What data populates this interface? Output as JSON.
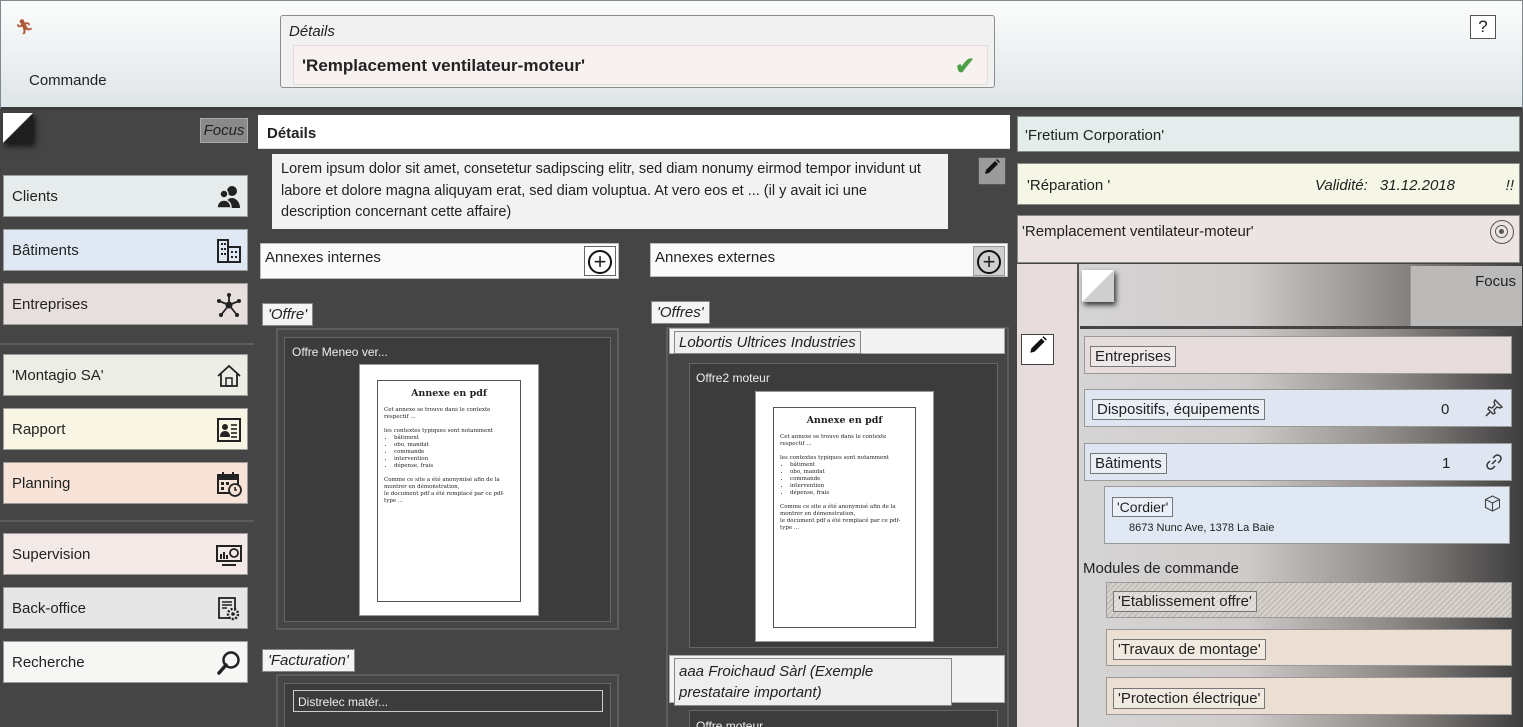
{
  "header": {
    "module_label": "Commande",
    "details_legend": "Détails",
    "details_value": "'Remplacement ventilateur-moteur'",
    "help_label": "?"
  },
  "sidebar": {
    "focus_label": "Focus",
    "items": [
      {
        "label": "Clients",
        "icon": "users-icon",
        "color": "#e6ebec"
      },
      {
        "label": "Bâtiments",
        "icon": "buildings-icon",
        "color": "#e0e8f4"
      },
      {
        "label": "Entreprises",
        "icon": "network-icon",
        "color": "#e7dede"
      },
      {
        "label": "'Montagio SA'",
        "icon": "home-icon",
        "color": "#eceee6"
      },
      {
        "label": "Rapport",
        "icon": "report-icon",
        "color": "#f9f5e4"
      },
      {
        "label": "Planning",
        "icon": "calendar-icon",
        "color": "#f7e3d7"
      },
      {
        "label": "Supervision",
        "icon": "monitor-icon",
        "color": "#f3e9e7"
      },
      {
        "label": "Back-office",
        "icon": "settings-doc-icon",
        "color": "#e6e6e6"
      },
      {
        "label": "Recherche",
        "icon": "search-icon",
        "color": "#f6f7f4"
      }
    ]
  },
  "main": {
    "title": "Détails",
    "description": "Lorem ipsum dolor sit amet, consetetur sadipscing elitr, sed diam nonumy eirmod tempor invidunt ut labore et dolore magna aliquyam erat, sed diam voluptua. At vero eos et ... (il y avait ici une description concernant cette affaire)",
    "internal_label": "Annexes internes",
    "external_label": "Annexes externes",
    "internal_groups": [
      {
        "tag": "'Offre'",
        "card_title": "Offre Meneo ver..."
      },
      {
        "tag": "'Facturation'",
        "card_title": "Distrelec matér..."
      }
    ],
    "external_groups": [
      {
        "tag": "'Offres'"
      }
    ],
    "external_firms": [
      {
        "name": "Lobortis Ultrices Industries",
        "card_title": "Offre2 moteur"
      },
      {
        "name": "aaa Froichaud Sàrl (Exemple prestataire important)",
        "card_title": "Offre moteur"
      }
    ],
    "pdf": {
      "title": "Annexe en pdf",
      "line1": "Cet annexe se trouve dans le contexte respectif ...",
      "line2": "les contextes typiques sont notamment",
      "bullets": [
        "bâtiment",
        "obo, mandat",
        "commande",
        "intervention",
        "dépense, frais"
      ],
      "line3": "Comme ce site a été anonymisé afin de la montrer en démonstration,",
      "line4": "le document pdf a été remplacé par ce pdf-type ..."
    }
  },
  "right": {
    "company": "'Fretium Corporation'",
    "type": "'Réparation '",
    "validity_label": "Validité:",
    "validity_date": "31.12.2018",
    "validity_flag": "!!",
    "order_title": "'Remplacement ventilateur-moteur'",
    "focus_label": "Focus",
    "rows": [
      {
        "label": "Entreprises",
        "count": ""
      },
      {
        "label": "Dispositifs, équipements",
        "count": "0"
      },
      {
        "label": "Bâtiments",
        "count": "1"
      }
    ],
    "building": {
      "name": "'Cordier'",
      "address": "8673 Nunc Ave, 1378 La Baie"
    },
    "modules_label": "Modules de commande",
    "modules": [
      "'Etablissement offre'",
      "'Travaux de montage'",
      "'Protection électrique'"
    ]
  }
}
